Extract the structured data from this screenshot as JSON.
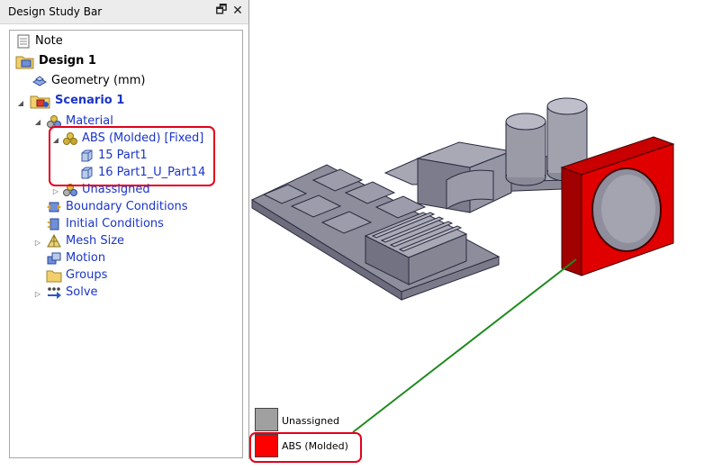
{
  "panel": {
    "title": "Design Study Bar",
    "restore_glyph": "🗗",
    "close_glyph": "✕"
  },
  "tree": {
    "note": "Note",
    "design": "Design 1",
    "geometry": "Geometry (mm)",
    "scenario": "Scenario 1",
    "material": "Material",
    "abs": "ABS (Molded) [Fixed]",
    "part1": "15 Part1",
    "part2": "16 Part1_U_Part14",
    "unassigned": "Unassigned",
    "boundary": "Boundary Conditions",
    "initial": "Initial Conditions",
    "mesh": "Mesh Size",
    "motion": "Motion",
    "groups": "Groups",
    "solve": "Solve"
  },
  "legend": {
    "items": [
      {
        "label": "Unassigned",
        "color": "#a0a0a0"
      },
      {
        "label": "ABS (Molded)",
        "color": "#ff0000"
      }
    ]
  },
  "colors": {
    "highlight": "#e3001b",
    "leader_line": "#1e8a1e",
    "link_text": "#1a35c8",
    "part_gray": "#9a9aa6",
    "part_red": "#e00000"
  }
}
